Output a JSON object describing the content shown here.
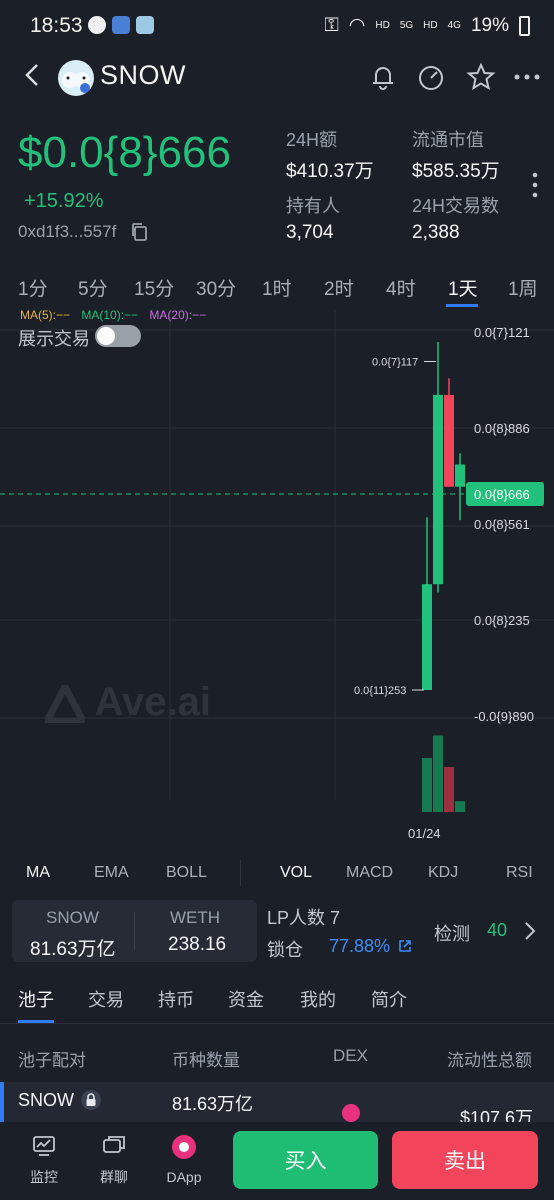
{
  "status_bar": {
    "time": "18:53",
    "battery": "19%",
    "network": [
      "HD",
      "5G",
      "HD",
      "4G"
    ]
  },
  "header": {
    "token_name": "SNOW",
    "icons": [
      "back-icon",
      "bell-icon",
      "gauge-icon",
      "star-icon",
      "more-icon"
    ]
  },
  "price_block": {
    "price": "$0.0{8}666",
    "change": "+15.92%",
    "address": "0xd1f3...557f"
  },
  "stats": [
    {
      "label": "24H额",
      "value": "$410.37万"
    },
    {
      "label": "流通市值",
      "value": "$585.35万"
    },
    {
      "label": "持有人",
      "value": "3,704"
    },
    {
      "label": "24H交易数",
      "value": "2,388"
    }
  ],
  "timeframes": [
    "1分",
    "5分",
    "15分",
    "30分",
    "1时",
    "2时",
    "4时",
    "1天",
    "1周"
  ],
  "active_timeframe": "1天",
  "ma_legend": [
    {
      "label": "MA(5):−−",
      "color": "#e6b33a"
    },
    {
      "label": "MA(10):−−",
      "color": "#21c07b"
    },
    {
      "label": "MA(20):−−",
      "color": "#c86de0"
    }
  ],
  "show_trades_label": "展示交易",
  "show_trades_on": false,
  "watermark": "Ave.ai",
  "chart_data": {
    "type": "candlestick",
    "y_tick_labels": [
      "0.0{7}121",
      "0.0{8}886",
      "0.0{8}561",
      "0.0{8}235",
      "-0.0{9}890"
    ],
    "current_price_label": "0.0{8}666",
    "high_annotation": "0.0{7}117",
    "low_annotation": "0.0{11}253",
    "x_tick_labels": [
      "01/24"
    ],
    "candles": [
      {
        "open": 0.0,
        "close": 0.38,
        "high": 0.62,
        "low": 0.0,
        "dir": "up"
      },
      {
        "open": 0.38,
        "close": 1.06,
        "high": 1.25,
        "low": 0.35,
        "dir": "up"
      },
      {
        "open": 1.06,
        "close": 0.73,
        "high": 1.12,
        "low": 0.73,
        "dir": "down"
      },
      {
        "open": 0.73,
        "close": 0.81,
        "high": 0.85,
        "low": 0.61,
        "dir": "up"
      }
    ],
    "volumes": [
      {
        "value": 0.6,
        "dir": "up"
      },
      {
        "value": 0.85,
        "dir": "up"
      },
      {
        "value": 0.5,
        "dir": "down"
      },
      {
        "value": 0.12,
        "dir": "up"
      }
    ],
    "colors": {
      "up": "#21c07b",
      "down": "#f2445a",
      "current_line": "#21c07b",
      "grid": "#2a2f38"
    }
  },
  "indicators": [
    "MA",
    "EMA",
    "BOLL",
    "VOL",
    "MACD",
    "KDJ",
    "RSI"
  ],
  "active_indicators": [
    "MA",
    "VOL"
  ],
  "pair": {
    "token_a": "SNOW",
    "amount_a": "81.63万亿",
    "token_b": "WETH",
    "amount_b": "238.16"
  },
  "lp": {
    "count_label": "LP人数 7",
    "lock_label": "锁仓",
    "lock_value": "77.88%",
    "check_label": "检测",
    "check_value": "40"
  },
  "tabs": [
    "池子",
    "交易",
    "持币",
    "资金",
    "我的",
    "简介"
  ],
  "active_tab": "池子",
  "pool_table": {
    "headers": [
      "池子配对",
      "币种数量",
      "DEX",
      "流动性总额"
    ],
    "rows": [
      {
        "pair": "SNOW",
        "quantity": "81.63万亿",
        "liquidity": "$107.6万"
      }
    ]
  },
  "bottom_nav": [
    {
      "label": "监控",
      "icon": "monitor-icon"
    },
    {
      "label": "群聊",
      "icon": "chat-icon"
    },
    {
      "label": "DApp",
      "icon": "dapp-icon"
    }
  ],
  "buy_label": "买入",
  "sell_label": "卖出"
}
